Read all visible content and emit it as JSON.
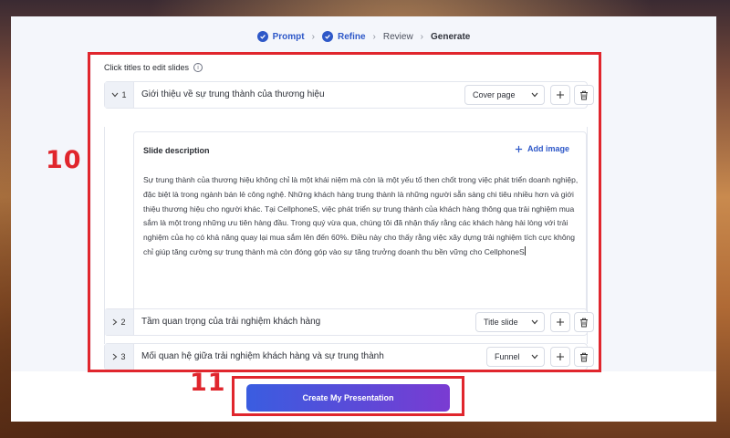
{
  "steps": [
    {
      "label": "Prompt",
      "done": true
    },
    {
      "label": "Refine",
      "done": true
    },
    {
      "label": "Review",
      "done": false
    },
    {
      "label": "Generate",
      "done": false,
      "current": true
    }
  ],
  "editor": {
    "hint": "Click titles to edit slides",
    "slides": [
      {
        "num": "1",
        "title": "Giới thiệu về sự trung thành của thương hiệu",
        "type": "Cover page",
        "expanded": true
      },
      {
        "num": "2",
        "title": "Tầm quan trọng của trải nghiệm khách hàng",
        "type": "Title slide",
        "expanded": false
      },
      {
        "num": "3",
        "title": "Mối quan hệ giữa trải nghiệm khách hàng và sự trung thành",
        "type": "Funnel",
        "expanded": false
      }
    ],
    "description_label": "Slide description",
    "add_image": "Add image",
    "description_text": "Sự trung thành của thương hiệu không chỉ là một khái niệm mà còn là một yếu tố then chốt trong việc phát triển doanh nghiệp, đặc biệt là trong ngành bán lẻ công nghệ. Những khách hàng trung thành là những người sẵn sàng chi tiêu nhiều hơn và giới thiệu thương hiệu cho người khác. Tại CellphoneS, việc phát triển sự trung thành của khách hàng thông qua trải nghiệm mua sắm là một trong những ưu tiên hàng đầu. Trong quý vừa qua, chúng tôi đã nhận thấy rằng các khách hàng hài lòng với trải nghiệm của họ có khả năng quay lại mua sắm lên đến 60%. Điều này cho thấy rằng việc xây dựng trải nghiệm tích cực không chỉ giúp tăng cường sự trung thành mà còn đóng góp vào sự tăng trưởng doanh thu bền vững cho CellphoneS"
  },
  "cta": {
    "label": "Create My Presentation"
  },
  "annotations": {
    "box1": "10",
    "box2": "11"
  },
  "colors": {
    "accent": "#2e58c8",
    "annotation": "#e0262d",
    "button_start": "#3a5de0",
    "button_end": "#7a3bd2"
  }
}
